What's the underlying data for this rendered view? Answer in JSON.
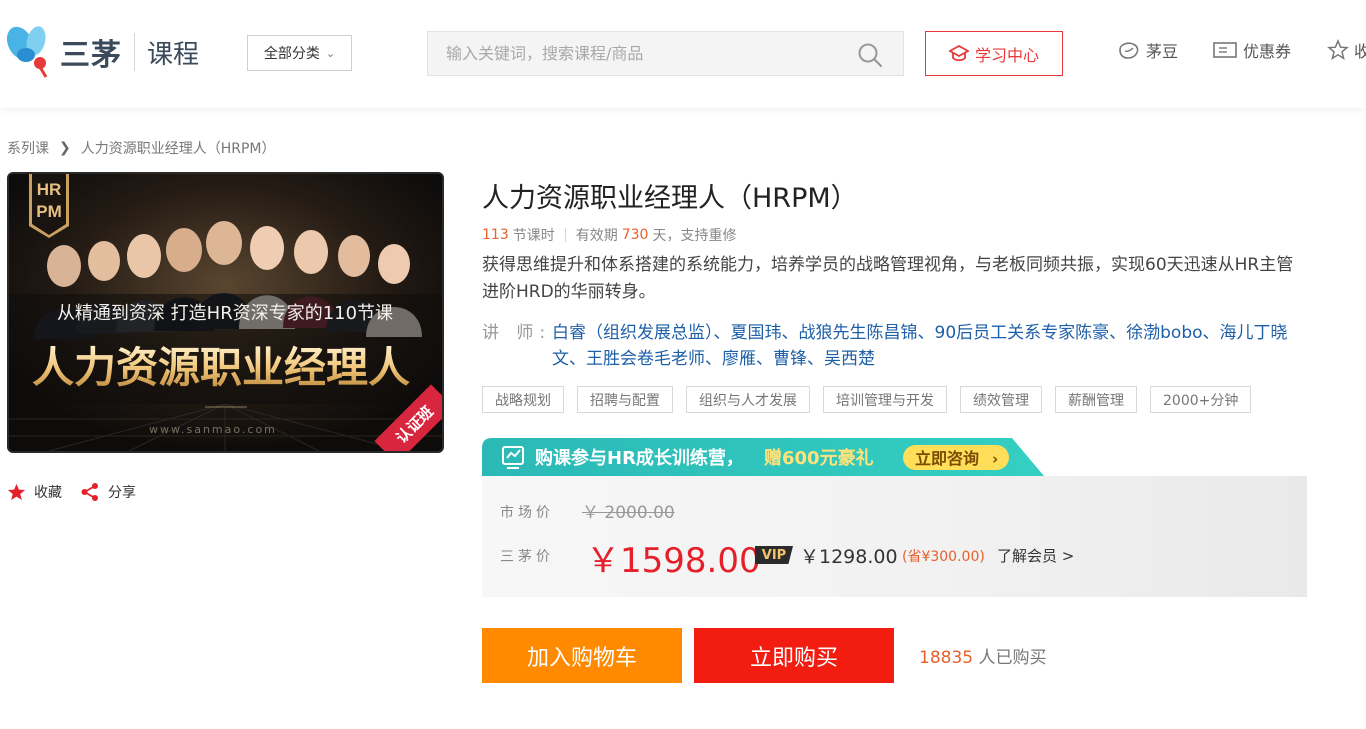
{
  "header": {
    "logo_text": "三茅",
    "logo_sub": "课程",
    "category_label": "全部分类",
    "search_placeholder": "输入关键词，搜索课程/商品",
    "study_center": "学习中心",
    "nav": [
      "茅豆",
      "优惠券",
      "收"
    ],
    "accent": "#e73939"
  },
  "breadcrumb": {
    "root": "系列课",
    "current": "人力资源职业经理人（HRPM）"
  },
  "cover": {
    "badge": [
      "HR",
      "PM"
    ],
    "subtitle": "从精通到资深  打造HR资深专家的110节课",
    "headline": "人力资源职业经理人",
    "website": "www.sanmao.com",
    "ribbon": "认证班"
  },
  "actions": {
    "favorite": "收藏",
    "share": "分享"
  },
  "course": {
    "title": "人力资源职业经理人（HRPM）",
    "lessons_count": "113",
    "lessons_unit": "节课时",
    "validity_prefix": "有效期",
    "validity_days": "730",
    "validity_suffix": "天，支持重修",
    "description": "获得思维提升和体系搭建的系统能力，培养学员的战略管理视角，与老板同频共振，实现60天迅速从HR主管进阶HRD的华丽转身。",
    "teacher_label": "讲  师:",
    "teachers": "白睿（组织发展总监）、夏国玮、战狼先生陈昌锦、90后员工关系专家陈豪、徐渤bobo、海儿丁晓文、王胜会卷毛老师、廖雁、曹锋、吴西楚",
    "tags": [
      "战略规划",
      "招聘与配置",
      "组织与人才发展",
      "培训管理与开发",
      "绩效管理",
      "薪酬管理",
      "2000+分钟"
    ]
  },
  "promo": {
    "text_a": "购课参与HR成长训练营，",
    "text_b": "赠600元豪礼",
    "consult": "立即咨询"
  },
  "pricing": {
    "market_label": "市场价",
    "market_price": "￥ 2000.00",
    "our_label": "三茅价",
    "our_price": "￥1598.00",
    "vip_label": "VIP",
    "vip_price": "￥1298.00",
    "save_text": "(省¥300.00)",
    "learn_member": "了解会员 >"
  },
  "buttons": {
    "cart": "加入购物车",
    "buy": "立即购买"
  },
  "sales": {
    "count": "18835",
    "suffix": "人已购买"
  }
}
